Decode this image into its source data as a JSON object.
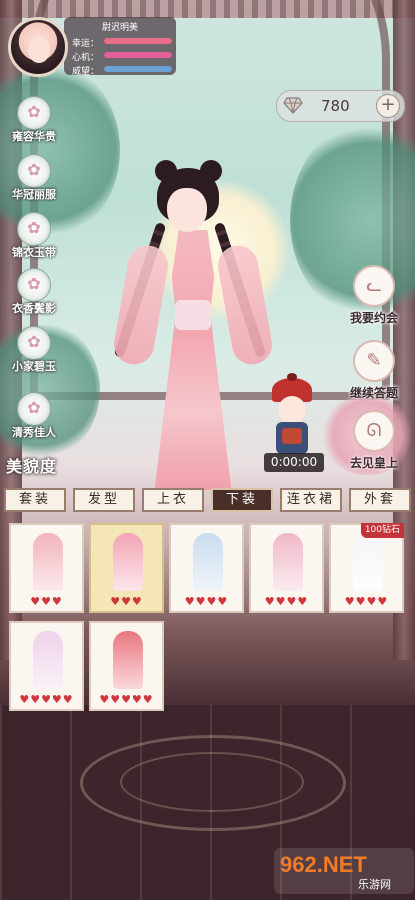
{
  "player": {
    "name": "尉迟明美",
    "stats": [
      {
        "label": "幸运：",
        "value": 1.0,
        "color": "#e96e8a"
      },
      {
        "label": "心机：",
        "value": 1.0,
        "color": "#e4609a"
      },
      {
        "label": "威望：",
        "value": 1.0,
        "color": "#6aa2d8"
      }
    ]
  },
  "currency": {
    "icon": "diamond-icon",
    "value": "780",
    "add_label": "+"
  },
  "categories": [
    {
      "label": "雍容华贵"
    },
    {
      "label": "华冠丽服"
    },
    {
      "label": "锦衣玉带"
    },
    {
      "label": "衣香鬓影"
    },
    {
      "label": "小家碧玉"
    },
    {
      "label": "清秀佳人"
    }
  ],
  "beauty_label": "美貌度",
  "timer": "0:00:00",
  "actions": [
    {
      "label": "我要约会",
      "icon": "cat-icon"
    },
    {
      "label": "继续答题",
      "icon": "notepad-icon"
    },
    {
      "label": "去见皇上",
      "icon": "rabbit-icon"
    }
  ],
  "tabs": [
    {
      "label": "套装"
    },
    {
      "label": "发型"
    },
    {
      "label": "上衣"
    },
    {
      "label": "下装",
      "active": true
    },
    {
      "label": "连衣裙"
    },
    {
      "label": "外套"
    }
  ],
  "items": [
    {
      "hearts": 3,
      "color": "#f2b3bd",
      "selected": false
    },
    {
      "hearts": 3,
      "color": "#f3a5b5",
      "selected": true
    },
    {
      "hearts": 4,
      "color": "#c9dcef",
      "selected": false
    },
    {
      "hearts": 4,
      "color": "#f0b8c8",
      "selected": false
    },
    {
      "hearts": 4,
      "color": "#f6f6f6",
      "selected": false,
      "badge": "100钻石"
    },
    {
      "hearts": 5,
      "color": "#efd2ea",
      "selected": false
    },
    {
      "hearts": 5,
      "color": "#e9777f",
      "selected": false
    }
  ],
  "watermark": {
    "brand": "962.NET",
    "sub": "乐游网"
  }
}
